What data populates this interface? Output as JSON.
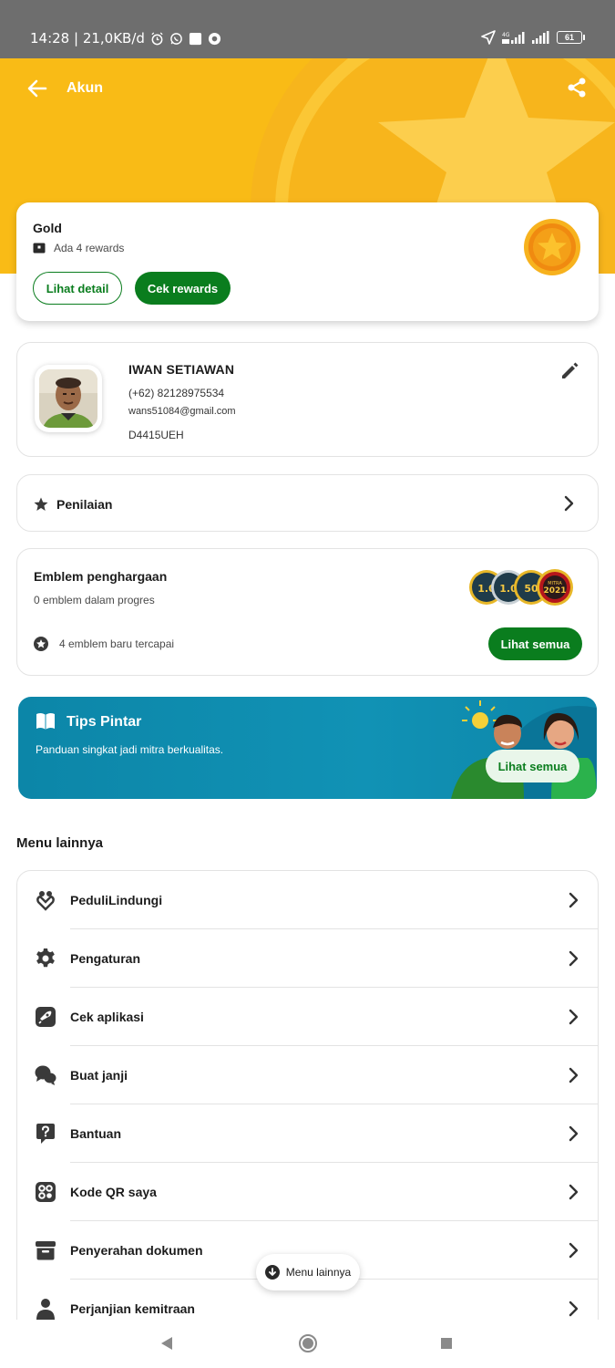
{
  "status_bar": {
    "time_speed": "14:28 | 21,0KB/d",
    "battery": "61",
    "network": "4G"
  },
  "header": {
    "title": "Akun"
  },
  "tier_card": {
    "tier": "Gold",
    "rewards_text": "Ada 4 rewards",
    "detail_button": "Lihat detail",
    "rewards_button": "Cek rewards"
  },
  "profile": {
    "name": "IWAN SETIAWAN",
    "phone": "(+62) 82128975534",
    "email": "wans51084@gmail.com",
    "driver_id": "D4415UEH"
  },
  "rating": {
    "label": "Penilaian"
  },
  "emblem": {
    "title": "Emblem penghargaan",
    "progress_text": "0 emblem dalam progres",
    "new_text": "4 emblem baru tercapai",
    "see_all": "Lihat semua",
    "badges": [
      "1.0",
      "1.0",
      "50",
      "MITRA 2021"
    ]
  },
  "tips": {
    "title": "Tips Pintar",
    "subtitle": "Panduan singkat jadi mitra berkualitas.",
    "button": "Lihat semua"
  },
  "menu": {
    "title": "Menu lainnya",
    "items": [
      {
        "label": "PeduliLindungi",
        "icon": "care-protect-icon"
      },
      {
        "label": "Pengaturan",
        "icon": "gear-icon"
      },
      {
        "label": "Cek aplikasi",
        "icon": "rocket-icon"
      },
      {
        "label": "Buat janji",
        "icon": "chat-bubbles-icon"
      },
      {
        "label": "Bantuan",
        "icon": "help-icon"
      },
      {
        "label": "Kode QR saya",
        "icon": "qr-code-icon"
      },
      {
        "label": "Penyerahan dokumen",
        "icon": "archive-box-icon"
      },
      {
        "label": "Perjanjian kemitraan",
        "icon": "person-icon"
      }
    ]
  },
  "float_pill": {
    "label": "Menu lainnya"
  },
  "colors": {
    "header_yellow": "#f9bb16",
    "brand_green": "#0a7d1e",
    "tips_blue": "#1192b5"
  }
}
